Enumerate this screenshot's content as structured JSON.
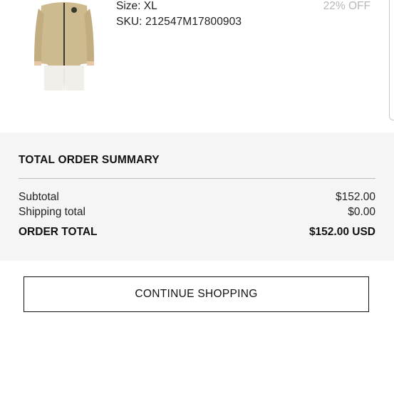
{
  "product": {
    "size_text": "Size: XL",
    "sku_text": "SKU: 212547M17800903",
    "discount_text": "22% OFF"
  },
  "summary": {
    "title": "TOTAL ORDER SUMMARY",
    "subtotal_label": "Subtotal",
    "subtotal_value": "$152.00",
    "shipping_label": "Shipping total",
    "shipping_value": "$0.00",
    "total_label": "ORDER TOTAL",
    "total_value": "$152.00 USD"
  },
  "actions": {
    "continue_label": "CONTINUE SHOPPING"
  }
}
